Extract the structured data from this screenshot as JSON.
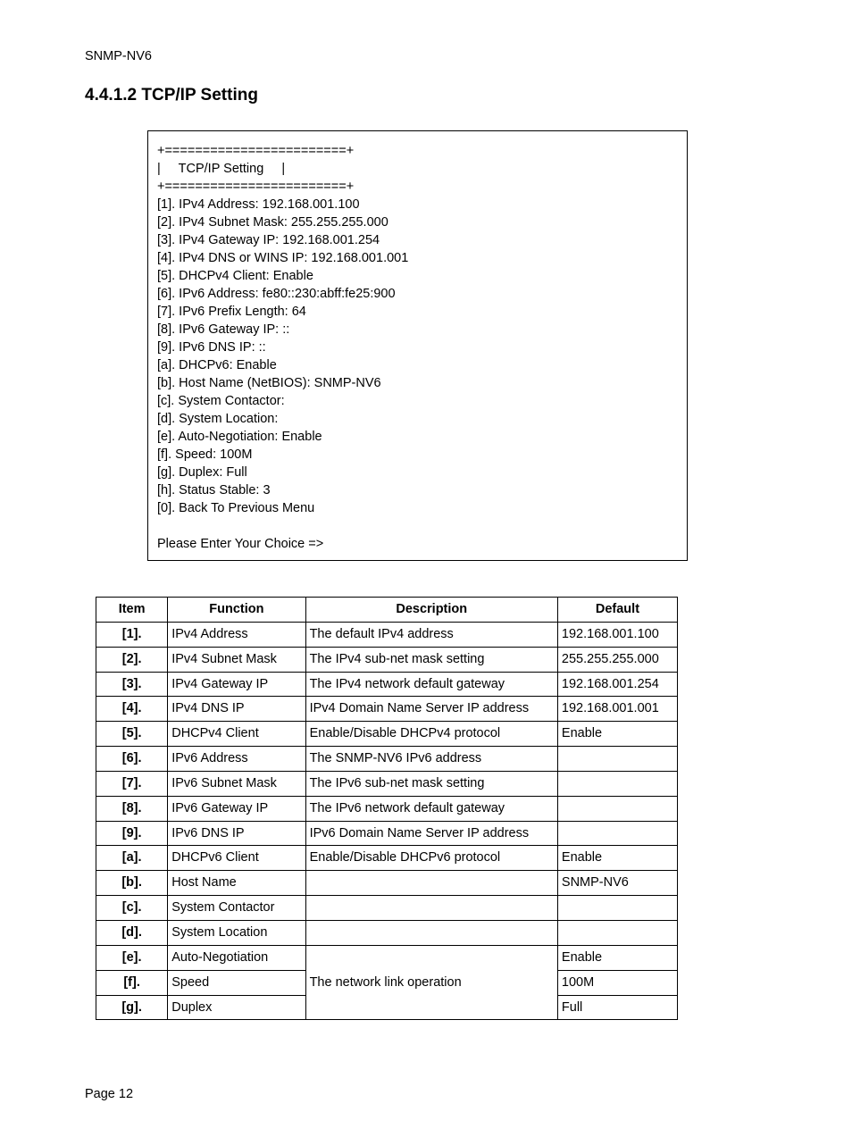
{
  "header": "SNMP-NV6",
  "section_title": "4.4.1.2 TCP/IP Setting",
  "terminal": {
    "border_top": "+========================+",
    "title_row": "|     TCP/IP Setting     |",
    "border_bot": "+========================+",
    "lines": [
      "[1]. IPv4 Address: 192.168.001.100",
      "[2]. IPv4 Subnet Mask: 255.255.255.000",
      "[3]. IPv4 Gateway IP: 192.168.001.254",
      "[4]. IPv4 DNS or WINS IP: 192.168.001.001",
      "[5]. DHCPv4 Client: Enable",
      "[6]. IPv6 Address: fe80::230:abff:fe25:900",
      "[7]. IPv6 Prefix Length: 64",
      "[8]. IPv6 Gateway IP: ::",
      "[9]. IPv6 DNS IP: ::",
      "[a]. DHCPv6: Enable",
      "[b]. Host Name (NetBIOS): SNMP-NV6",
      "[c]. System Contactor:",
      "[d]. System Location:",
      "[e]. Auto-Negotiation: Enable",
      "[f]. Speed: 100M",
      "[g]. Duplex: Full",
      "[h]. Status Stable: 3",
      "[0]. Back To Previous Menu"
    ],
    "prompt": "Please Enter Your Choice =>"
  },
  "table": {
    "headers": {
      "item": "Item",
      "function": "Function",
      "description": "Description",
      "default": "Default"
    },
    "rows": [
      {
        "item": "[1].",
        "function": "IPv4 Address",
        "description": "The default IPv4 address",
        "default": "192.168.001.100"
      },
      {
        "item": "[2].",
        "function": "IPv4 Subnet Mask",
        "description": "The IPv4 sub-net mask setting",
        "default": "255.255.255.000"
      },
      {
        "item": "[3].",
        "function": "IPv4 Gateway IP",
        "description": "The IPv4 network default gateway",
        "default": "192.168.001.254"
      },
      {
        "item": "[4].",
        "function": "IPv4 DNS IP",
        "description": "IPv4 Domain Name Server IP address",
        "default": "192.168.001.001"
      },
      {
        "item": "[5].",
        "function": "DHCPv4 Client",
        "description": "Enable/Disable DHCPv4 protocol",
        "default": "Enable"
      },
      {
        "item": "[6].",
        "function": "IPv6 Address",
        "description": "The SNMP-NV6 IPv6 address",
        "default": ""
      },
      {
        "item": "[7].",
        "function": "IPv6 Subnet Mask",
        "description": "The IPv6 sub-net mask setting",
        "default": ""
      },
      {
        "item": "[8].",
        "function": "IPv6 Gateway IP",
        "description": "The IPv6 network default gateway",
        "default": ""
      },
      {
        "item": "[9].",
        "function": "IPv6 DNS IP",
        "description": "IPv6 Domain Name Server IP address",
        "default": ""
      },
      {
        "item": "[a].",
        "function": "DHCPv6 Client",
        "description": "Enable/Disable DHCPv6 protocol",
        "default": "Enable"
      },
      {
        "item": "[b].",
        "function": "Host Name",
        "description": "",
        "default": "SNMP-NV6"
      },
      {
        "item": "[c].",
        "function": "System Contactor",
        "description": "",
        "default": ""
      },
      {
        "item": "[d].",
        "function": "System Location",
        "description": "",
        "default": ""
      }
    ],
    "merged_group": {
      "description": "The network link operation",
      "rows": [
        {
          "item": "[e].",
          "function": "Auto-Negotiation",
          "default": "Enable"
        },
        {
          "item": "[f].",
          "function": "Speed",
          "default": "100M"
        },
        {
          "item": "[g].",
          "function": "Duplex",
          "default": "Full"
        }
      ]
    }
  },
  "footer": "Page 12"
}
